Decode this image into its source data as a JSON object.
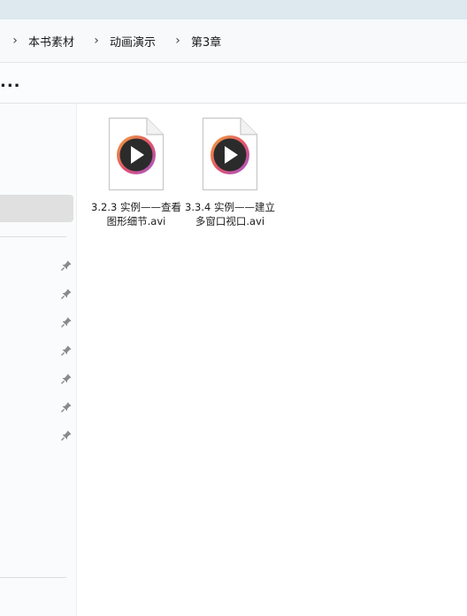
{
  "breadcrumb": {
    "items": [
      "本书素材",
      "动画演示",
      "第3章"
    ],
    "separator": "›"
  },
  "toolbar": {
    "more_label": "..."
  },
  "nav": {
    "pinned_count": 7
  },
  "files": [
    {
      "name": "3.2.3  实例——查看图形细节.avi",
      "icon": "video-file-icon"
    },
    {
      "name": "3.3.4  实例——建立多窗口视口.avi",
      "icon": "video-file-icon"
    }
  ],
  "colors": {
    "titlebar": "#dde8ef",
    "selection": "#e0e0e0",
    "play_ring_start": "#f0a33a",
    "play_ring_end": "#a05ad6"
  }
}
